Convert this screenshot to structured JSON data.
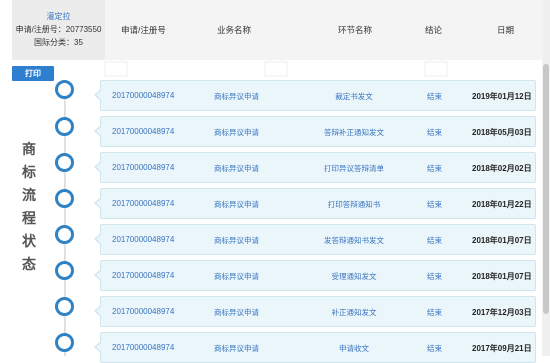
{
  "info": {
    "applicant": "灌定拉",
    "reg_no_text": "申请/注册号：20773550",
    "class_text": "国际分类：35"
  },
  "header": {
    "col_reg_no": "申请/注册号",
    "col_business": "业务名称",
    "col_step": "环节名称",
    "col_result": "结论",
    "col_date": "日期"
  },
  "print_label": "打印",
  "side_title": [
    "商",
    "标",
    "流",
    "程",
    "状",
    "态"
  ],
  "rows": [
    {
      "reg_no": "20170000048974",
      "business": "商标异议申请",
      "step": "裁定书发文",
      "result": "结束",
      "date": "2019年01月12日"
    },
    {
      "reg_no": "20170000048974",
      "business": "商标异议申请",
      "step": "答辩补正通知发文",
      "result": "结束",
      "date": "2018年05月03日"
    },
    {
      "reg_no": "20170000048974",
      "business": "商标异议申请",
      "step": "打印异议答辩清单",
      "result": "结束",
      "date": "2018年02月02日"
    },
    {
      "reg_no": "20170000048974",
      "business": "商标异议申请",
      "step": "打印答辩通知书",
      "result": "结束",
      "date": "2018年01月22日"
    },
    {
      "reg_no": "20170000048974",
      "business": "商标异议申请",
      "step": "发答辩通知书发文",
      "result": "结束",
      "date": "2018年01月07日"
    },
    {
      "reg_no": "20170000048974",
      "business": "商标异议申请",
      "step": "受理通知发文",
      "result": "结束",
      "date": "2018年01月07日"
    },
    {
      "reg_no": "20170000048974",
      "business": "商标异议申请",
      "step": "补正通知发文",
      "result": "结束",
      "date": "2017年12月03日"
    },
    {
      "reg_no": "20170000048974",
      "business": "商标异议申请",
      "step": "申请收文",
      "result": "结束",
      "date": "2017年09月21日"
    }
  ]
}
